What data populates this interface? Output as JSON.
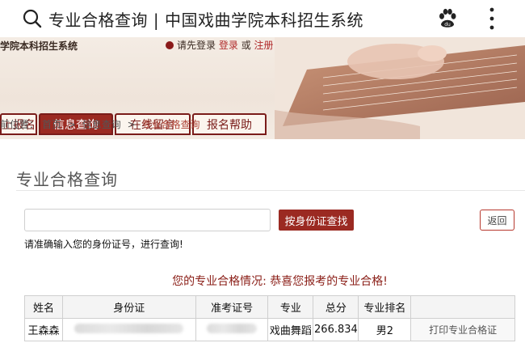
{
  "browser": {
    "title": "专业合格查询 | 中国戏曲学院本科招生系统"
  },
  "banner": {
    "school_name": "学院本科招生系统",
    "login_prompt": "请先登录",
    "login_link": "登录",
    "or": "或",
    "register_link": "注册"
  },
  "nav": {
    "tabs": [
      "上报名",
      "信息查询",
      "在线留言",
      "报名帮助"
    ],
    "active_index": 1
  },
  "breadcrumb": {
    "prefix": "前位置：",
    "home": "首页",
    "sep": ">",
    "parent": "信息查询",
    "current": "专业合格查询"
  },
  "main": {
    "section_title": "专业合格查询",
    "id_input_value": "",
    "id_input_placeholder": "",
    "search_button": "按身份证查找",
    "back_button": "返回",
    "hint": "请准确输入您的身份证号，进行查询!",
    "result_label": "您的专业合格情况:",
    "result_text": "恭喜您报考的专业合格!"
  },
  "table": {
    "headers": [
      "姓名",
      "身份证",
      "准考证号",
      "专业",
      "总分",
      "专业排名",
      ""
    ],
    "row": {
      "name": "王森森",
      "major": "戏曲舞蹈",
      "score": "266.834",
      "rank": "男2",
      "print_button": "打印专业合格证"
    }
  },
  "colors": {
    "accent": "#9b2a22",
    "result_text": "#8a1d16"
  }
}
